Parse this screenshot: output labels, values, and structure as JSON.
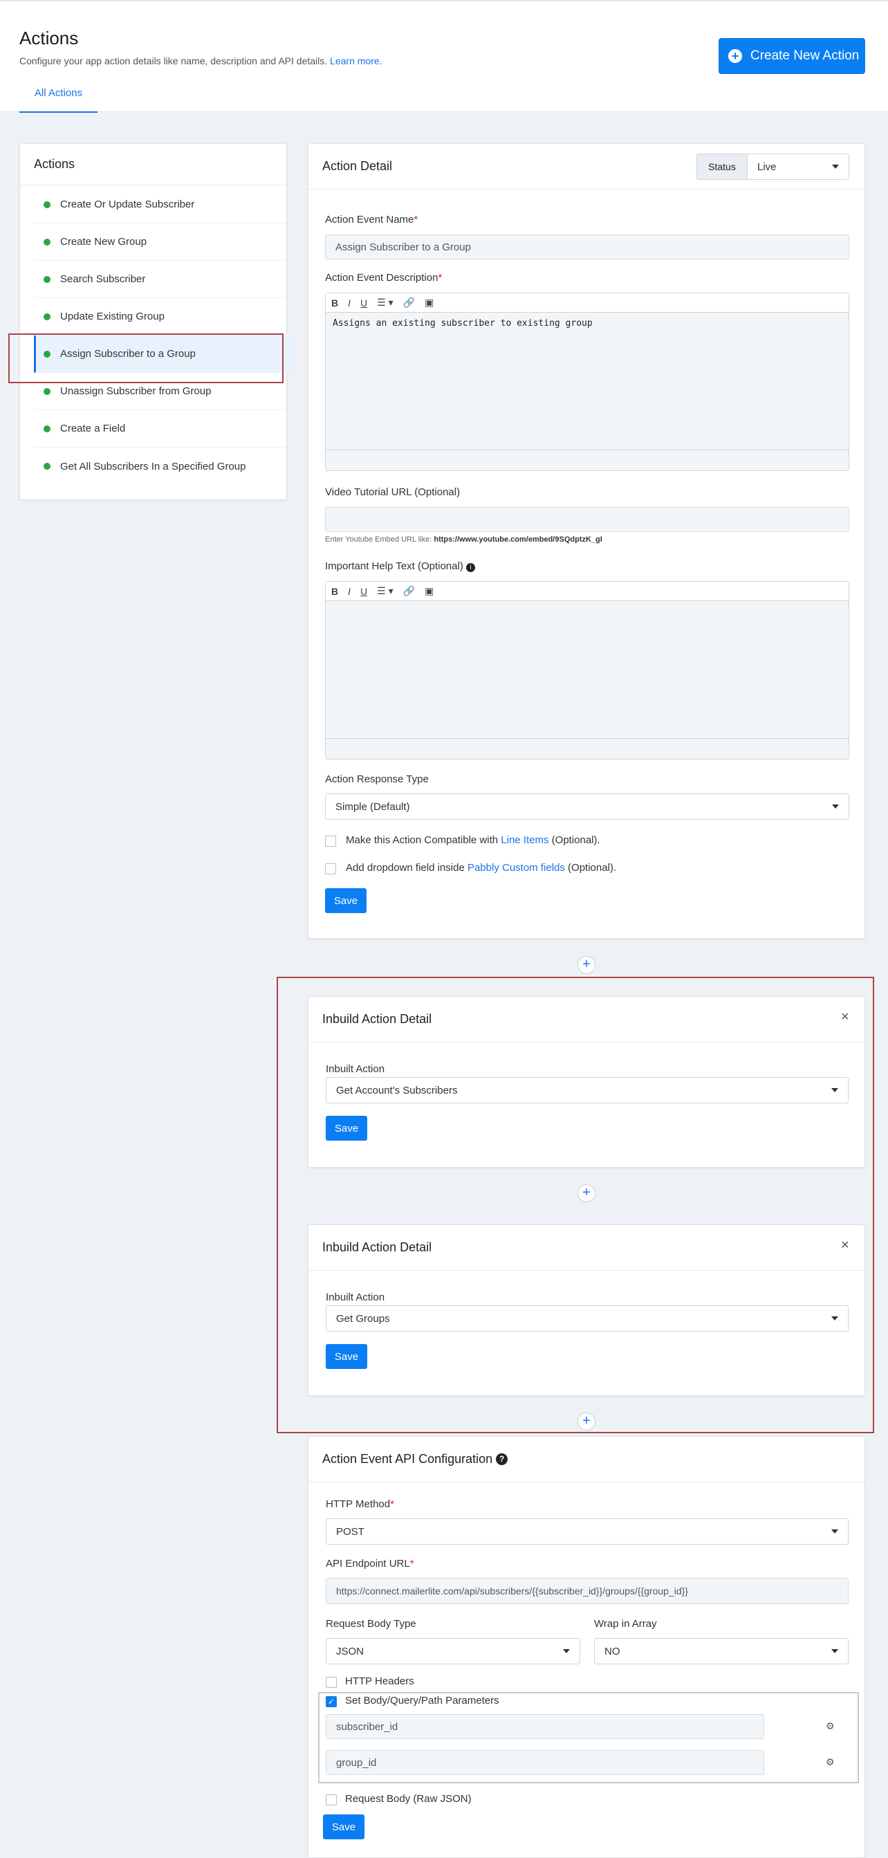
{
  "header": {
    "title": "Actions",
    "subtitle": "Configure your app action details like name, description and API details.",
    "learn_more": "Learn more.",
    "tab": "All Actions",
    "create_button": "Create New Action"
  },
  "sidebar": {
    "title": "Actions",
    "items": [
      {
        "label": "Create Or Update Subscriber"
      },
      {
        "label": "Create New Group"
      },
      {
        "label": "Search Subscriber"
      },
      {
        "label": "Update Existing Group"
      },
      {
        "label": "Assign Subscriber to a Group"
      },
      {
        "label": "Unassign Subscriber from Group"
      },
      {
        "label": "Create a Field"
      },
      {
        "label": "Get All Subscribers In a Specified Group"
      }
    ]
  },
  "detail": {
    "title": "Action Detail",
    "status_label": "Status",
    "status_value": "Live",
    "event_name_label": "Action Event Name",
    "event_name_value": "Assign Subscriber to a Group",
    "desc_label": "Action Event Description",
    "desc_value": "Assigns an existing subscriber to existing group",
    "video_label": "Video Tutorial URL (Optional)",
    "video_hint_prefix": "Enter Youtube Embed URL like:",
    "video_hint_url": "https://www.youtube.com/embed/9SQdptzK_gI",
    "help_label": "Important Help Text (Optional)",
    "response_label": "Action Response Type",
    "response_value": "Simple (Default)",
    "line_items_pre": "Make this Action Compatible with",
    "line_items_link": "Line Items",
    "line_items_post": "(Optional).",
    "dropdown_pre": "Add dropdown field inside",
    "dropdown_link": "Pabbly Custom fields",
    "dropdown_post": "(Optional).",
    "save": "Save"
  },
  "inbuilt": [
    {
      "title": "Inbuild Action Detail",
      "label": "Inbuilt Action",
      "value": "Get Account's Subscribers",
      "save": "Save",
      "close": "×"
    },
    {
      "title": "Inbuild Action Detail",
      "label": "Inbuilt Action",
      "value": "Get Groups",
      "save": "Save",
      "close": "×"
    }
  ],
  "api": {
    "title": "Action Event API Configuration",
    "method_label": "HTTP Method",
    "method_value": "POST",
    "endpoint_label": "API Endpoint URL",
    "endpoint_value": "https://connect.mailerlite.com/api/subscribers/{{subscriber_id}}/groups/{{group_id}}",
    "body_type_label": "Request Body Type",
    "body_type_value": "JSON",
    "wrap_label": "Wrap in Array",
    "wrap_value": "NO",
    "headers_label": "HTTP Headers",
    "params_label": "Set Body/Query/Path Parameters",
    "params": [
      "subscriber_id",
      "group_id"
    ],
    "raw_label": "Request Body (Raw JSON)",
    "save": "Save"
  },
  "toolbar": {
    "bold": "B",
    "italic": "I",
    "underline": "U",
    "list": "☰ ▾",
    "link": "🔗",
    "image": "▣"
  },
  "plus": "+",
  "colors": {
    "accent": "#0a7ef2",
    "status_dot": "#28a745",
    "highlight": "#a84444"
  }
}
